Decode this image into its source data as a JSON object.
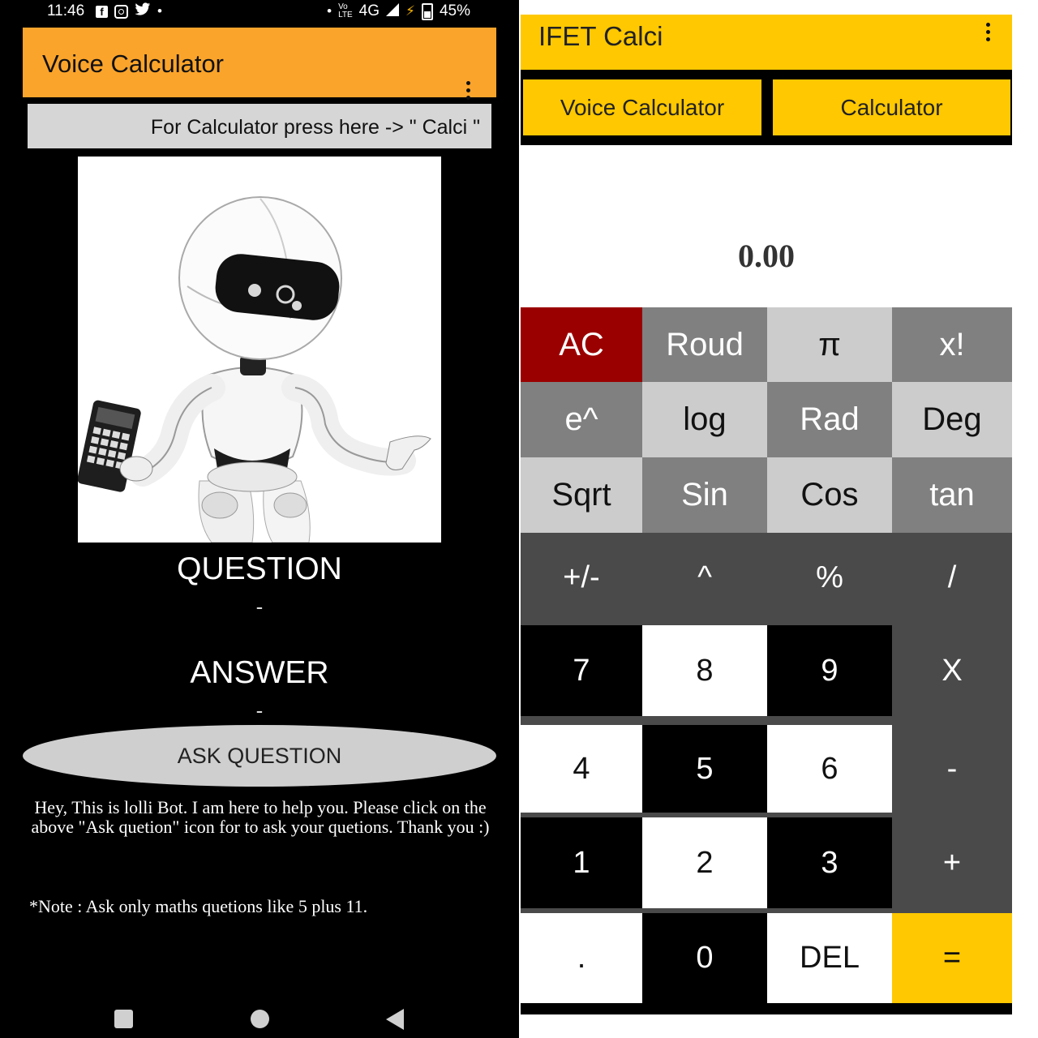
{
  "left_screen": {
    "status": {
      "time": "11:46",
      "left_icons": [
        "facebook-icon",
        "instagram-icon",
        "twitter-icon",
        "dot-icon"
      ],
      "right_icons": [
        "dot-icon",
        "volte-icon",
        "signal-4g-icon",
        "data-saver-icon",
        "battery-icon"
      ],
      "network": "4G",
      "battery": "45%"
    },
    "appbar": {
      "title": "Voice Calculator"
    },
    "calci_link": "For Calculator press here -> \" Calci \"",
    "question_label": "QUESTION",
    "question_value": "-",
    "answer_label": "ANSWER",
    "answer_value": "-",
    "ask_button": "ASK QUESTION",
    "bot_message": "Hey, This is lolli Bot. I am here to help you. Please click on the above \"Ask quetion\" icon for to ask your quetions. Thank you :)",
    "note": "*Note : Ask only maths quetions like 5 plus 11.",
    "colors": {
      "appbar": "#FBA42B",
      "background": "#000000",
      "ask_button": "#CFCFCF"
    }
  },
  "right_screen": {
    "appbar": {
      "title": "IFET Calci"
    },
    "tabs": [
      {
        "label": "Voice Calculator"
      },
      {
        "label": "Calculator"
      }
    ],
    "display": "0.00",
    "keys": [
      {
        "label": "AC",
        "name": "ac-key"
      },
      {
        "label": "Roud",
        "name": "round-key"
      },
      {
        "label": "π",
        "name": "pi-key"
      },
      {
        "label": "x!",
        "name": "factorial-key"
      },
      {
        "label": "e^",
        "name": "exp-key"
      },
      {
        "label": "log",
        "name": "log-key"
      },
      {
        "label": "Rad",
        "name": "rad-key"
      },
      {
        "label": "Deg",
        "name": "deg-key"
      },
      {
        "label": "Sqrt",
        "name": "sqrt-key"
      },
      {
        "label": "Sin",
        "name": "sin-key"
      },
      {
        "label": "Cos",
        "name": "cos-key"
      },
      {
        "label": "tan",
        "name": "tan-key"
      },
      {
        "label": "+/-",
        "name": "sign-key"
      },
      {
        "label": "^",
        "name": "power-key"
      },
      {
        "label": "%",
        "name": "percent-key"
      },
      {
        "label": "/",
        "name": "divide-key"
      },
      {
        "label": "7",
        "name": "digit-7-key"
      },
      {
        "label": "8",
        "name": "digit-8-key"
      },
      {
        "label": "9",
        "name": "digit-9-key"
      },
      {
        "label": "X",
        "name": "multiply-key"
      },
      {
        "label": "4",
        "name": "digit-4-key"
      },
      {
        "label": "5",
        "name": "digit-5-key"
      },
      {
        "label": "6",
        "name": "digit-6-key"
      },
      {
        "label": "-",
        "name": "minus-key"
      },
      {
        "label": "1",
        "name": "digit-1-key"
      },
      {
        "label": "2",
        "name": "digit-2-key"
      },
      {
        "label": "3",
        "name": "digit-3-key"
      },
      {
        "label": "+",
        "name": "plus-key"
      },
      {
        "label": ".",
        "name": "decimal-key"
      },
      {
        "label": "0",
        "name": "digit-0-key"
      },
      {
        "label": "DEL",
        "name": "delete-key"
      },
      {
        "label": "=",
        "name": "equals-key"
      }
    ],
    "colors": {
      "appbar": "#FFC800",
      "ac_key": "#9B0000",
      "equals_key": "#FFC800",
      "dark_gray": "#808080",
      "light_gray": "#CCCCCC",
      "operator_gray": "#4A4A4A",
      "black": "#000000",
      "white": "#FFFFFF"
    }
  }
}
